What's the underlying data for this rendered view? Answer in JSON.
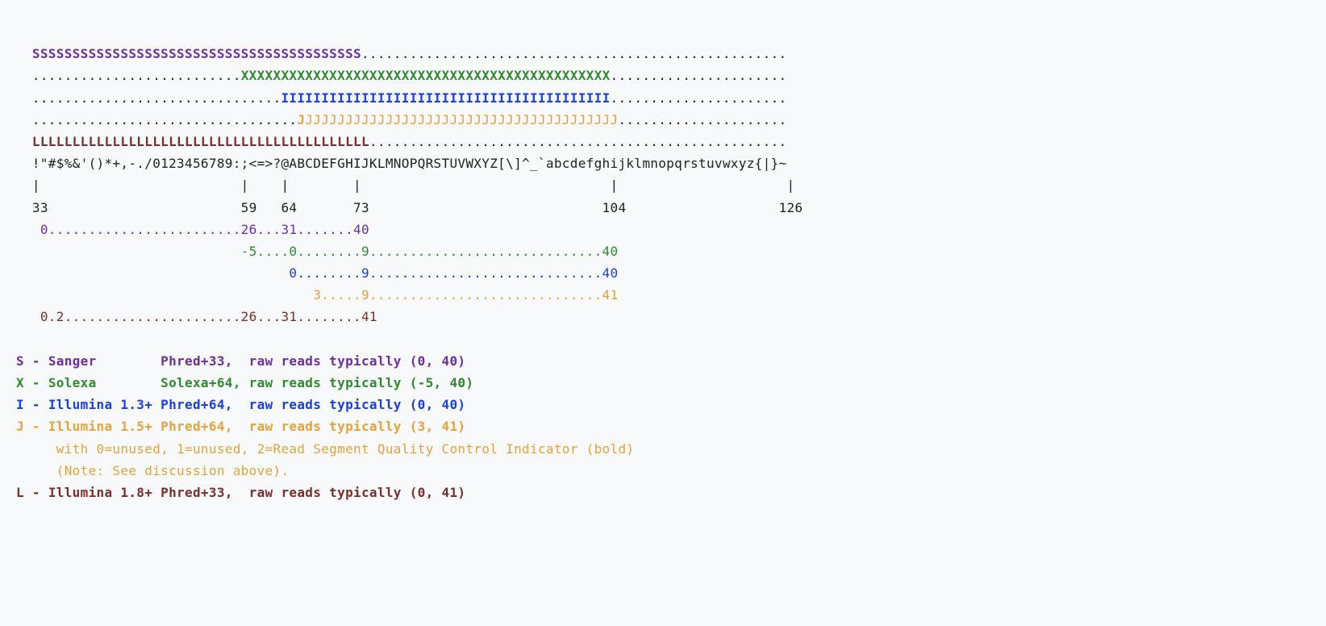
{
  "colors": {
    "S": "#6b2fa3",
    "X": "#2f8b2f",
    "I": "#1a3fe0",
    "J": "#e6a23c",
    "L": "#7a2e2e",
    "K": "#202122"
  },
  "chart_data": {
    "type": "table",
    "title": "FASTQ quality-score ASCII encoding ranges for common sequencing formats",
    "ascii_axis": "!\"#$%&'()*+,-./0123456789:;<=>?@ABCDEFGHIJKLMNOPQRSTUVWXYZ[\\]^_`abcdefghijklmnopqrstuvwxyz{|}~",
    "ascii_ticks": [
      33,
      59,
      64,
      73,
      104,
      126
    ],
    "encodings": [
      {
        "code": "S",
        "name": "Sanger",
        "offset_label": "Phred+33",
        "ascii_start": 33,
        "ascii_end": 73,
        "score_min": 0,
        "score_max": 40,
        "score_marks": [
          0,
          26,
          31,
          40
        ]
      },
      {
        "code": "X",
        "name": "Solexa",
        "offset_label": "Solexa+64",
        "ascii_start": 59,
        "ascii_end": 104,
        "score_min": -5,
        "score_max": 40,
        "score_marks": [
          -5,
          0,
          9,
          40
        ]
      },
      {
        "code": "I",
        "name": "Illumina 1.3+",
        "offset_label": "Phred+64",
        "ascii_start": 64,
        "ascii_end": 104,
        "score_min": 0,
        "score_max": 40,
        "score_marks": [
          0,
          9,
          40
        ]
      },
      {
        "code": "J",
        "name": "Illumina 1.5+",
        "offset_label": "Phred+64",
        "ascii_start": 66,
        "ascii_end": 105,
        "score_min": 3,
        "score_max": 41,
        "score_marks": [
          3,
          9,
          41
        ],
        "note": "with 0=unused, 1=unused, 2=Read Segment Quality Control Indicator (bold)  (Note: See discussion above)."
      },
      {
        "code": "L",
        "name": "Illumina 1.8+",
        "offset_label": "Phred+33",
        "ascii_start": 33,
        "ascii_end": 74,
        "score_min": 0,
        "score_max": 41,
        "score_marks": [
          0,
          2,
          26,
          31,
          41
        ]
      }
    ]
  },
  "spacer": "  ",
  "lead_pad": "  ",
  "lines": {
    "S_body": "SSSSSSSSSSSSSSSSSSSSSSSSSSSSSSSSSSSSSSSSS",
    "S_tail": ".....................................................",
    "X_lead": "..........................",
    "X_body": "XXXXXXXXXXXXXXXXXXXXXXXXXXXXXXXXXXXXXXXXXXXXXX",
    "X_tail": "......................",
    "I_lead": "...............................",
    "I_body": "IIIIIIIIIIIIIIIIIIIIIIIIIIIIIIIIIIIIIIIII",
    "I_tail": "......................",
    "J_lead": ".................................",
    "J_bold": "J",
    "J_body": "JJJJJJJJJJJJJJJJJJJJJJJJJJJJJJJJJJJJJJJ",
    "J_tail": ".....................",
    "L_body": "LLLLLLLLLLLLLLLLLLLLLLLLLLLLLLLLLLLLLLLLLL",
    "L_tail": "....................................................",
    "ascii_row": "!\"#$%&'()*+,-./0123456789:;<=>?@ABCDEFGHIJKLMNOPQRSTUVWXYZ[\\]^_`abcdefghijklmnopqrstuvwxyz{|}~",
    "tick_bars": "|                         |    |        |                               |                     |",
    "tick_nums": "33                        59   64       73                             104                   126",
    "scale_S": " 0........................26...31.......40",
    "scale_X": "                          -5....0........9.............................40",
    "scale_I": "                                0........9.............................40",
    "scale_J": "                                   3.....9.............................41",
    "scale_L": " 0.2......................26...31........41"
  },
  "legend": {
    "S": {
      "code": "S",
      "dash": " - ",
      "name": "Sanger       ",
      "offset": " Phred+33,  ",
      "desc": "raw reads typically (0, 40)"
    },
    "X": {
      "code": "X",
      "dash": " - ",
      "name": "Solexa       ",
      "offset": " Solexa+64, ",
      "desc": "raw reads typically (-5, 40)"
    },
    "I": {
      "code": "I",
      "dash": " - ",
      "name": "Illumina 1.3+",
      "offset": " Phred+64,  ",
      "desc": "raw reads typically (0, 40)"
    },
    "J": {
      "code": "J",
      "dash": " - ",
      "name": "Illumina 1.5+",
      "offset": " Phred+64,  ",
      "desc": "raw reads typically (3, 41)"
    },
    "J_note1": "     with 0=unused, 1=unused, 2=Read Segment Quality Control Indicator (bold)",
    "J_note2": "     (Note: See discussion above).",
    "L": {
      "code": "L",
      "dash": " - ",
      "name": "Illumina 1.8+",
      "offset": " Phred+33,  ",
      "desc": "raw reads typically (0, 41)"
    }
  }
}
